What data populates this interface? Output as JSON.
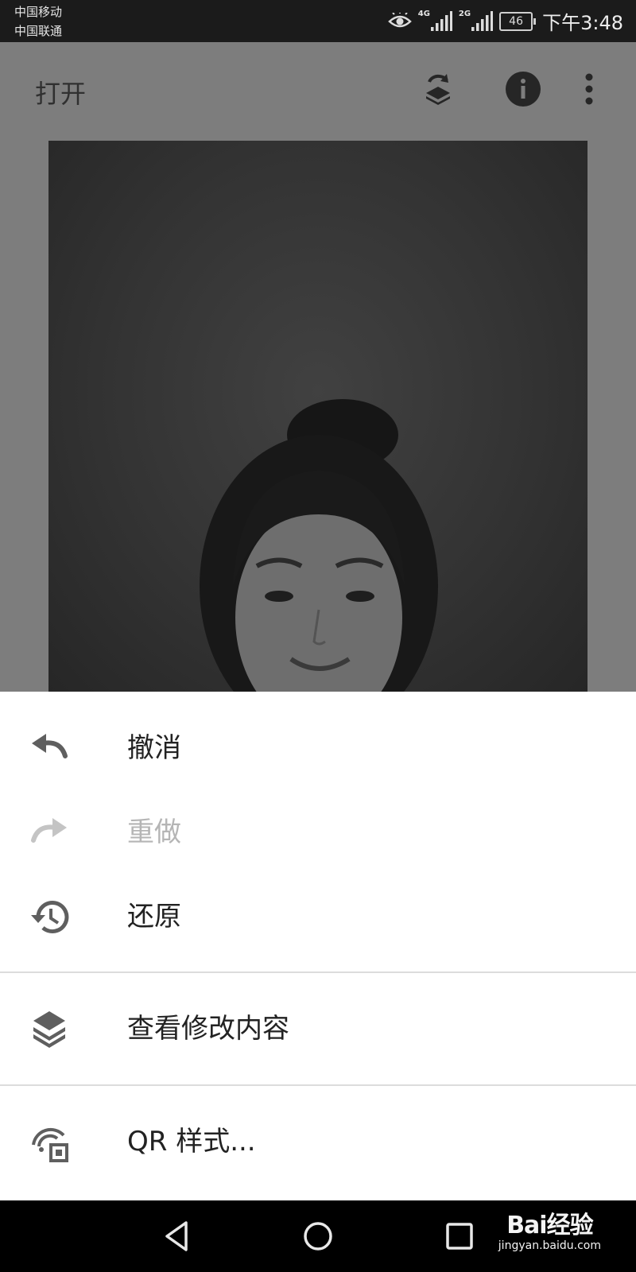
{
  "status_bar": {
    "carrier_1": "中国移动",
    "carrier_2": "中国联通",
    "network_1": "4G",
    "network_2": "2G",
    "battery": "46",
    "time": "下午3:48"
  },
  "app_bar": {
    "title": "打开"
  },
  "menu": {
    "items": [
      {
        "label": "撤消",
        "icon": "undo-icon",
        "enabled": true
      },
      {
        "label": "重做",
        "icon": "redo-icon",
        "enabled": false
      },
      {
        "label": "还原",
        "icon": "history-icon",
        "enabled": true
      },
      {
        "label": "查看修改内容",
        "icon": "layers-icon",
        "enabled": true
      },
      {
        "label": "QR 样式...",
        "icon": "qr-style-icon",
        "enabled": true
      }
    ]
  },
  "watermark": {
    "brand": "Bai经验",
    "url": "jingyan.baidu.com"
  },
  "colors": {
    "sheet_background": "#ffffff",
    "text_primary": "#222222",
    "text_disabled": "#b5b5b5",
    "icon": "#5f5f5f",
    "scrim": "#7d7d7d"
  }
}
